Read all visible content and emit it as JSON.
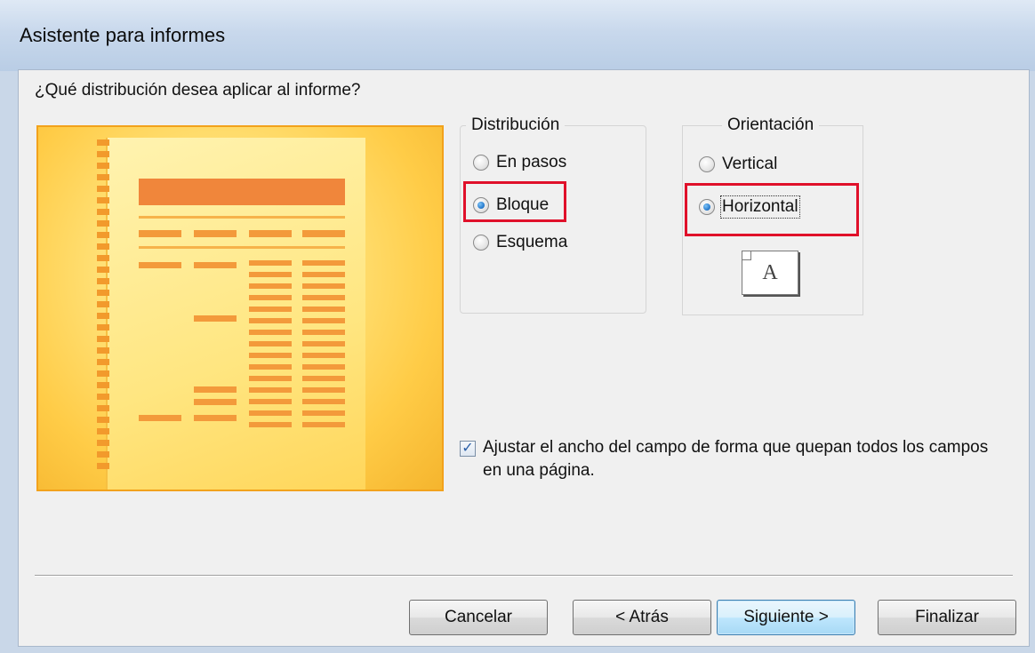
{
  "window": {
    "title": "Asistente para informes"
  },
  "question": "¿Qué distribución desea aplicar al informe?",
  "distribution": {
    "legend": "Distribución",
    "options": [
      {
        "label": "En pasos",
        "checked": false
      },
      {
        "label": "Bloque",
        "checked": true
      },
      {
        "label": "Esquema",
        "checked": false
      }
    ]
  },
  "orientation": {
    "legend": "Orientación",
    "options": [
      {
        "label": "Vertical",
        "checked": false
      },
      {
        "label": "Horizontal",
        "checked": true
      }
    ],
    "icon_letter": "A"
  },
  "fit_checkbox": {
    "checked": true,
    "label": "Ajustar el ancho del campo de forma que quepan todos los campos en una página."
  },
  "buttons": {
    "cancel": "Cancelar",
    "back": "< Atrás",
    "next": "Siguiente >",
    "finish": "Finalizar"
  },
  "colors": {
    "highlight": "#e0102a",
    "preview_border": "#f2a21c",
    "preview_bar": "#f39a3b"
  }
}
